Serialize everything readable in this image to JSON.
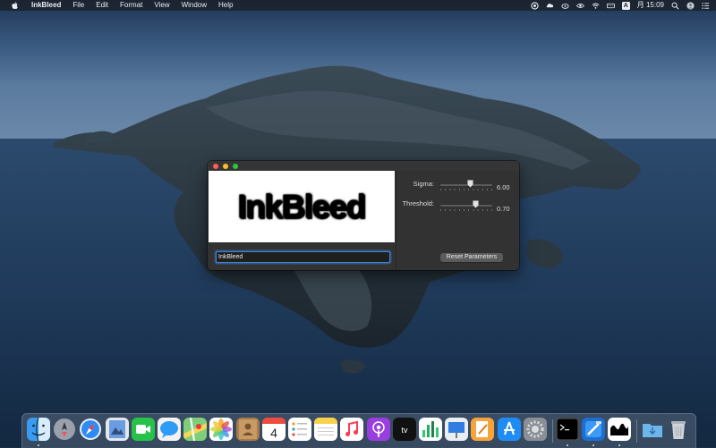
{
  "menubar": {
    "app_name": "InkBleed",
    "menus": [
      "File",
      "Edit",
      "Format",
      "View",
      "Window",
      "Help"
    ],
    "status_icons": [
      "vpn-icon",
      "creative-cloud-icon",
      "cloud-icon",
      "eye-icon",
      "wifi-icon",
      "keyboard-icon",
      "input-source-icon"
    ],
    "input_source": "A",
    "clock": "月 15:09",
    "right_icons": [
      "spotlight-icon",
      "user-icon",
      "notification-center-icon"
    ]
  },
  "window": {
    "preview_text": "InkBleed",
    "text_field_value": "InkBleed",
    "parameters": [
      {
        "label": "Sigma:",
        "value_text": "6.00",
        "fraction": 0.58
      },
      {
        "label": "Threshold:",
        "value_text": "0.70",
        "fraction": 0.68
      }
    ],
    "reset_button_label": "Reset Parameters"
  },
  "dock": {
    "apps": [
      {
        "name": "finder-icon",
        "running": true
      },
      {
        "name": "launchpad-icon",
        "running": false
      },
      {
        "name": "safari-icon",
        "running": false
      },
      {
        "name": "preview-icon",
        "running": false
      },
      {
        "name": "facetime-icon",
        "running": false
      },
      {
        "name": "messages-icon",
        "running": false
      },
      {
        "name": "maps-icon",
        "running": false
      },
      {
        "name": "photos-icon",
        "running": false
      },
      {
        "name": "contacts-icon",
        "running": false
      },
      {
        "name": "calendar-icon",
        "running": false
      },
      {
        "name": "reminders-icon",
        "running": false
      },
      {
        "name": "notes-icon",
        "running": false
      },
      {
        "name": "music-icon",
        "running": false
      },
      {
        "name": "podcasts-icon",
        "running": false
      },
      {
        "name": "tv-icon",
        "running": false
      },
      {
        "name": "numbers-icon",
        "running": false
      },
      {
        "name": "keynote-icon",
        "running": false
      },
      {
        "name": "pages-icon",
        "running": false
      },
      {
        "name": "app-store-icon",
        "running": false
      },
      {
        "name": "system-preferences-icon",
        "running": false
      },
      {
        "name": "terminal-icon",
        "running": true
      },
      {
        "name": "xcode-icon",
        "running": true
      },
      {
        "name": "inkbleed-app-icon",
        "running": true
      },
      {
        "name": "downloads-folder-icon",
        "running": false
      },
      {
        "name": "trash-icon",
        "running": false
      }
    ],
    "calendar_day": "4",
    "tv_label": "tv"
  },
  "colors": {
    "menubar_bg": "#1c222e",
    "window_bg": "#323232",
    "focus_ring": "#3b84d8",
    "close": "#fd5e57",
    "minimize": "#febc2e",
    "zoom": "#2ac840"
  }
}
